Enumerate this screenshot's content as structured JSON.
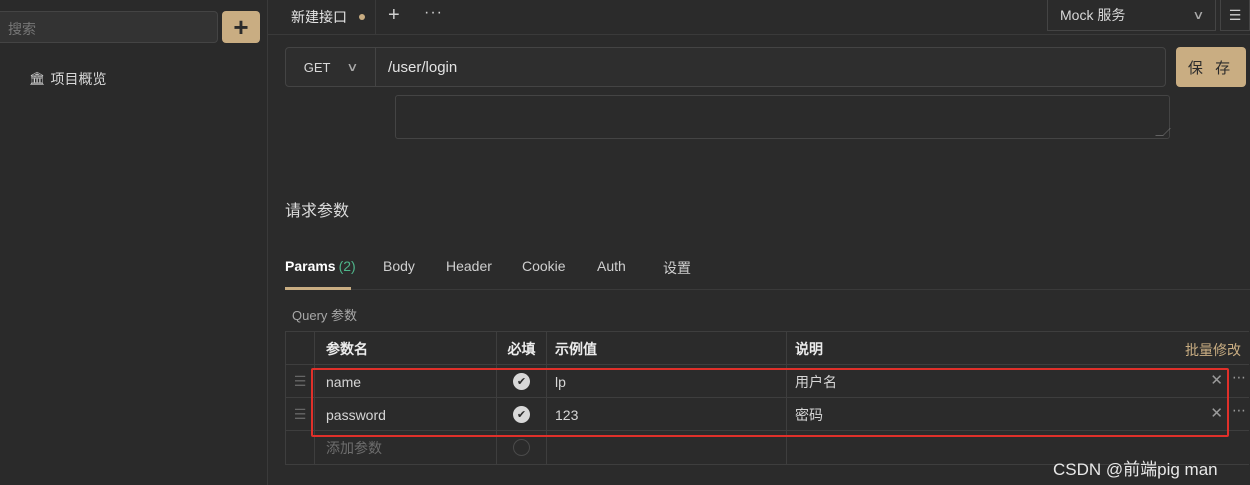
{
  "sidebar": {
    "search_placeholder": "搜索",
    "add_label": "+",
    "nav_item_label": "项目概览"
  },
  "tabs": {
    "active_tab": "新建接口",
    "plus": "+",
    "more": "···"
  },
  "mock": {
    "label": "Mock 服务"
  },
  "request": {
    "method": "GET",
    "url": "/user/login",
    "save_label": "保 存"
  },
  "section_title": "请求参数",
  "param_tabs": [
    {
      "label": "Params",
      "count": "(2)"
    },
    {
      "label": "Body"
    },
    {
      "label": "Header"
    },
    {
      "label": "Cookie"
    },
    {
      "label": "Auth"
    },
    {
      "label": "设置"
    }
  ],
  "query_label": "Query 参数",
  "table": {
    "headers": [
      "参数名",
      "必填",
      "示例值",
      "说明"
    ],
    "bulk_edit": "批量修改",
    "rows": [
      {
        "name": "name",
        "required": true,
        "example": "lp",
        "desc": "用户名"
      },
      {
        "name": "password",
        "required": true,
        "example": "123",
        "desc": "密码"
      }
    ],
    "add_placeholder": "添加参数"
  },
  "watermark": "CSDN @前端pig man",
  "colors": {
    "accent": "#c9ad82",
    "background": "#2b2b2b",
    "count_green": "#4fb58a",
    "highlight_red": "#e0302a"
  }
}
